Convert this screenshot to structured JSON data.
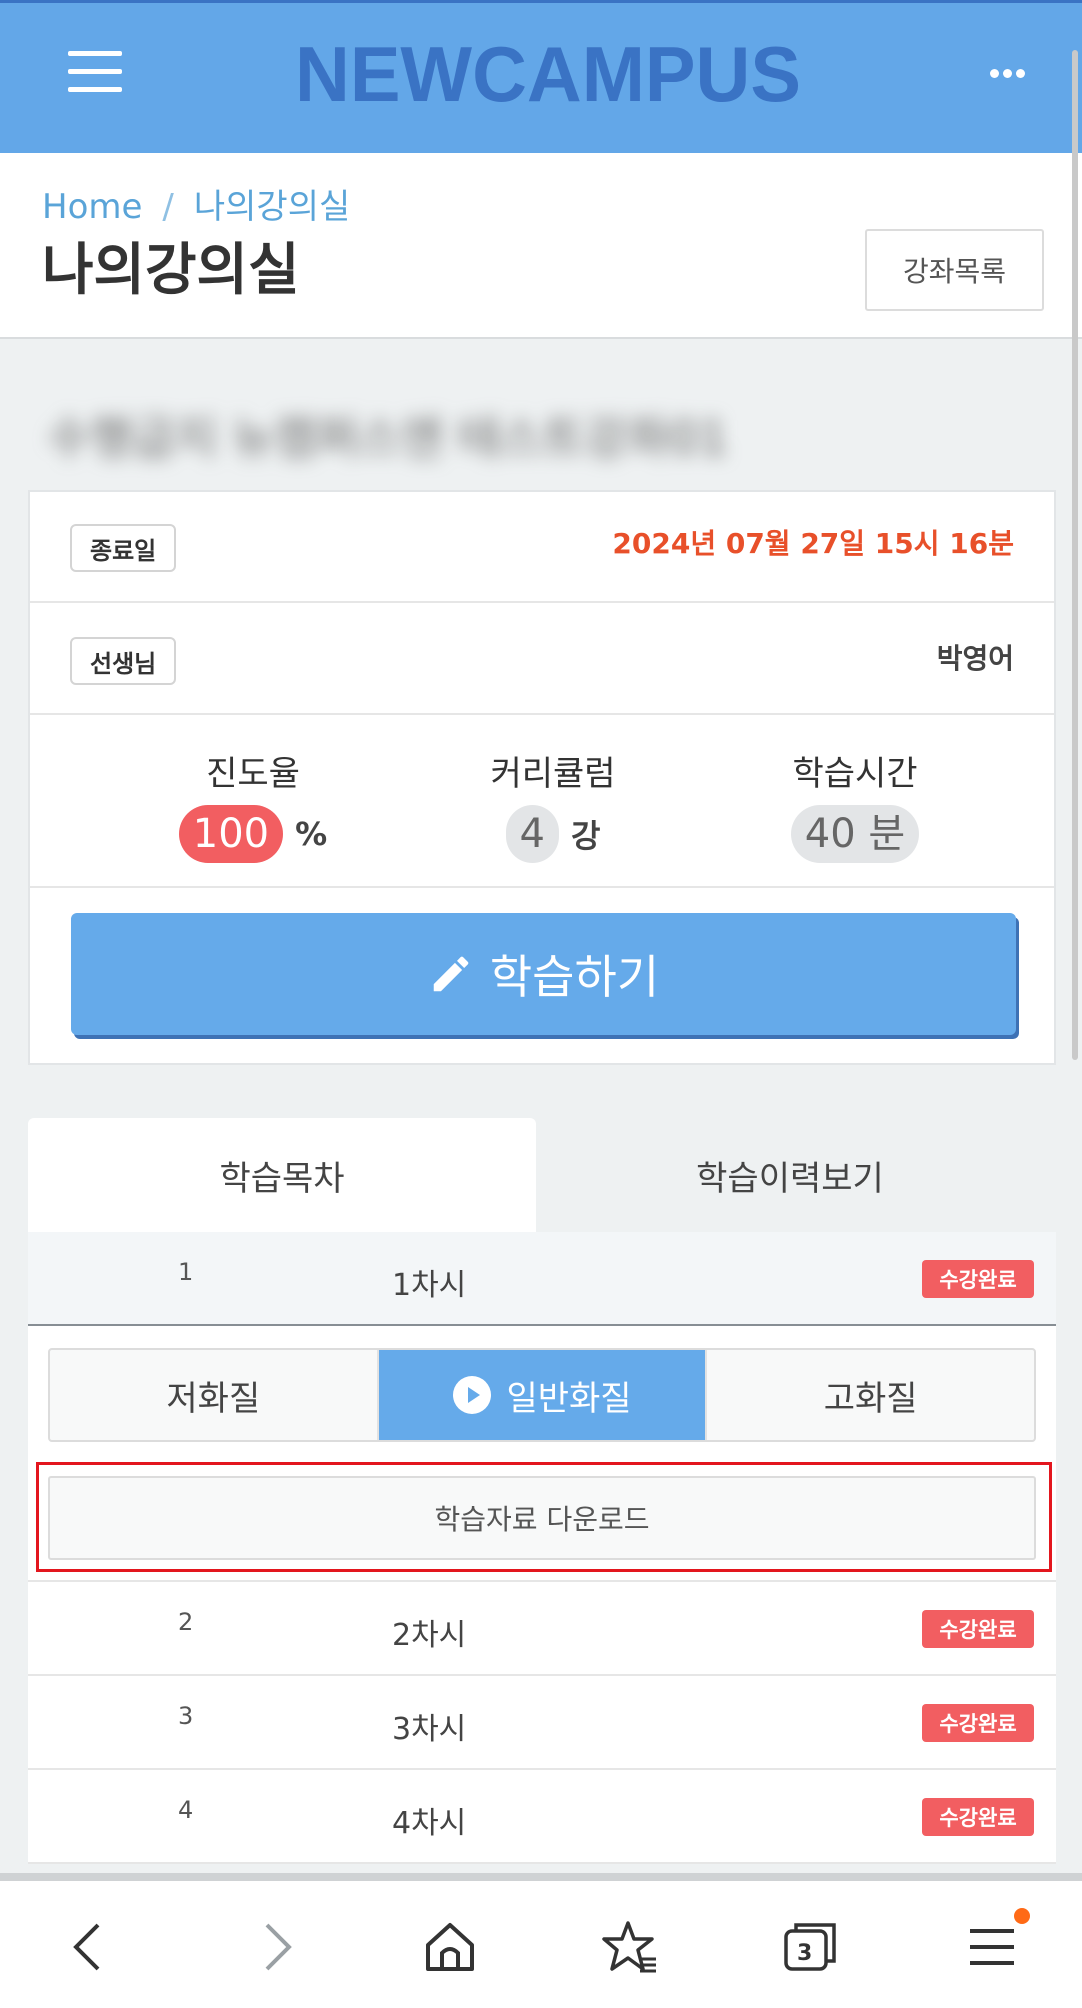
{
  "app": {
    "logo_text": "NEWCAMPUS"
  },
  "breadcrumb": {
    "home": "Home",
    "separator": "/",
    "current": "나의강의실"
  },
  "page_title": "나의강의실",
  "course_list_button": "강좌목록",
  "course_name_blurred": "수행급지 뉴캠퍼스엔 테스트강좌01",
  "info": {
    "end_date_tag": "종료일",
    "end_date_value": "2024년 07월 27일 15시 16분",
    "teacher_tag": "선생님",
    "teacher_value": "박영어"
  },
  "stats": {
    "progress": {
      "label": "진도율",
      "value": "100",
      "unit": "%"
    },
    "curriculum": {
      "label": "커리큘럼",
      "value": "4",
      "unit": "강"
    },
    "study_time": {
      "label": "학습시간",
      "value": "40",
      "unit": "분"
    }
  },
  "study_button": "학습하기",
  "tabs": {
    "toc": "학습목차",
    "history": "학습이력보기"
  },
  "lessons": [
    {
      "no": "1",
      "title": "1차시",
      "status": "수강완료"
    },
    {
      "no": "2",
      "title": "2차시",
      "status": "수강완료"
    },
    {
      "no": "3",
      "title": "3차시",
      "status": "수강완료"
    },
    {
      "no": "4",
      "title": "4차시",
      "status": "수강완료"
    }
  ],
  "quality": {
    "low": "저화질",
    "normal": "일반화질",
    "high": "고화질"
  },
  "download_button": "학습자료 다운로드",
  "bottom_nav": {
    "tabs_count": "3"
  },
  "colors": {
    "brand_blue": "#63a7e8",
    "logo_blue": "#3a73c4",
    "badge_red": "#f25e61",
    "date_orange": "#e8502a"
  }
}
